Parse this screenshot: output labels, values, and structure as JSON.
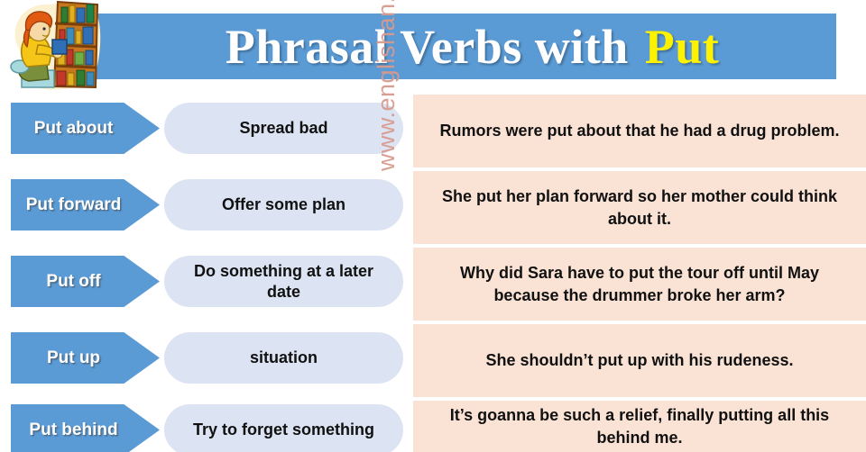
{
  "header": {
    "title_main": "Phrasal Verbs with",
    "title_keyword": "Put",
    "bar_color": "#5B9BD5",
    "title_color": "#FFFFFF",
    "keyword_color": "#FFF200",
    "illustration_alt": "woman-kneeling-at-bookshelf"
  },
  "watermark": {
    "text": "www.englishan.com",
    "color": "#D89A8E"
  },
  "palette": {
    "arrow_blue": "#5B9BD5",
    "pill_blue": "#DCE3F2",
    "example_peach": "#FAE3D5",
    "text_dark": "#111111"
  },
  "rows": [
    {
      "phrase": "Put about",
      "meaning": "Spread bad",
      "example": "Rumors were put about that he had a drug problem."
    },
    {
      "phrase": "Put forward",
      "meaning": "Offer some plan",
      "example": "She put her plan forward so her mother could think about it."
    },
    {
      "phrase": "Put off",
      "meaning": "Do something at a later date",
      "example": "Why did Sara have to put the tour off until May because the drummer broke her arm?"
    },
    {
      "phrase": "Put up",
      "meaning": "situation",
      "example": "She shouldn’t put up with his rudeness."
    },
    {
      "phrase": "Put behind",
      "meaning": "Try to forget something",
      "example": "It’s goanna be such a relief, finally putting all this behind me."
    }
  ]
}
